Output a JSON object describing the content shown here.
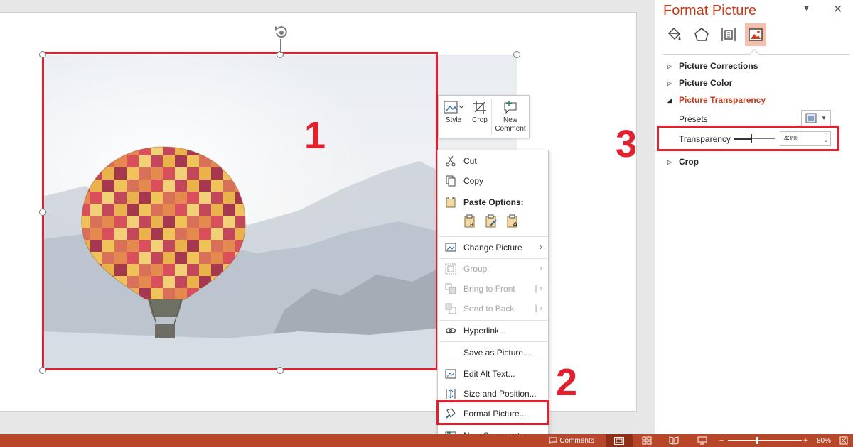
{
  "steps": {
    "one": "1",
    "two": "2",
    "three": "3"
  },
  "mini_toolbar": {
    "style_label": "Style",
    "crop_label": "Crop",
    "new_comment_line1": "New",
    "new_comment_line2": "Comment"
  },
  "context_menu": {
    "cut": "Cut",
    "copy": "Copy",
    "paste_options": "Paste Options:",
    "change_picture": "Change Picture",
    "group": "Group",
    "bring_to_front": "Bring to Front",
    "send_to_back": "Send to Back",
    "hyperlink": "Hyperlink...",
    "save_as_picture": "Save as Picture...",
    "edit_alt_text": "Edit Alt Text...",
    "size_and_position": "Size and Position...",
    "format_picture": "Format Picture...",
    "new_comment": "New Comment"
  },
  "format_pane": {
    "title": "Format Picture",
    "sections": {
      "corrections": "Picture Corrections",
      "color": "Picture Color",
      "transparency": "Picture Transparency",
      "crop": "Crop"
    },
    "presets_label": "Presets",
    "transparency_label": "Transparency",
    "transparency_value": "43%",
    "transparency_fraction": 0.43
  },
  "status_bar": {
    "comments_label": "Comments",
    "zoom_label": "80%",
    "zoom_minus": "−",
    "zoom_plus": "+"
  },
  "colors": {
    "accent": "#c43e1c",
    "highlight": "#e2202e",
    "status_bar": "#b7472a"
  }
}
